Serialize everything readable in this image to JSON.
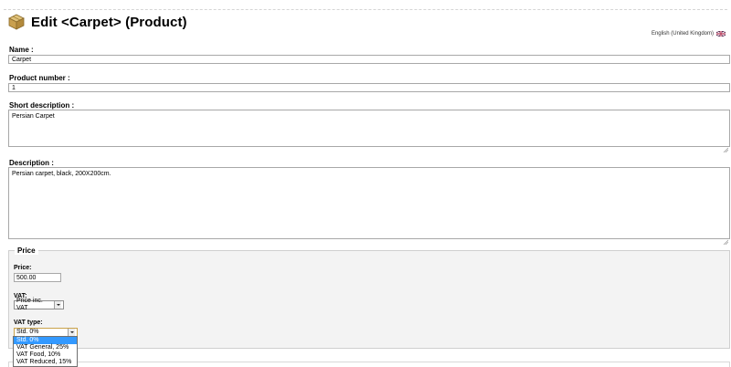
{
  "header": {
    "title": "Edit <Carpet> (Product)",
    "icon": "box-icon"
  },
  "language": {
    "label": "English (United Kingdom)",
    "icon": "uk-flag-icon"
  },
  "form": {
    "name_label": "Name :",
    "name_value": "Carpet",
    "product_number_label": "Product number :",
    "product_number_value": "1",
    "short_description_label": "Short description :",
    "short_description_value": "Persian Carpet",
    "description_label": "Description :",
    "description_value": "Persian carpet, black, 200X200cm."
  },
  "price": {
    "legend": "Price",
    "price_label": "Price:",
    "price_value": "500.00",
    "vat_label": "VAT:",
    "vat_selected": "Price inc. VAT",
    "vat_type_label": "VAT type:",
    "vat_type_selected": "Std. 0%",
    "vat_type_options": [
      "Std. 0%",
      "VAT General, 25%",
      "VAT Food, 10%",
      "VAT Reduced, 15%"
    ]
  },
  "colors": {
    "selected_option": "#3399ff",
    "fieldset_bg": "#f3f3f3",
    "focus_border": "#c9a24a"
  }
}
